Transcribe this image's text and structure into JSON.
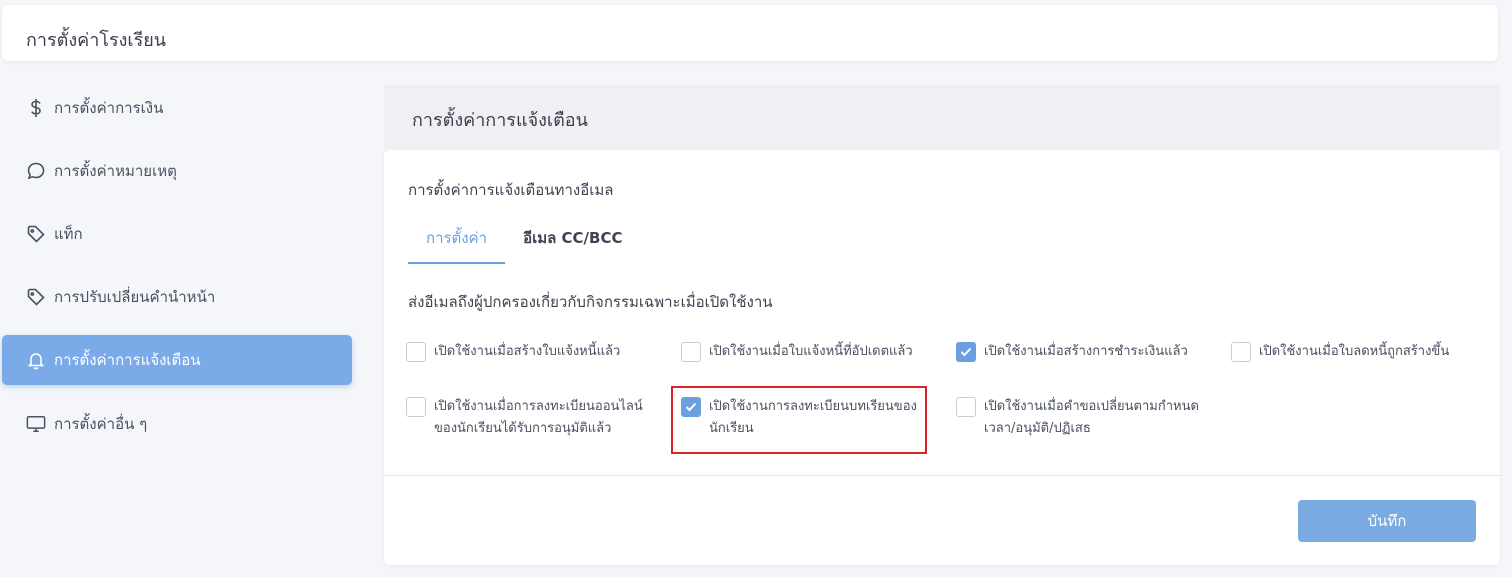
{
  "header": {
    "title": "การตั้งค่าโรงเรียน"
  },
  "sidebar": {
    "items": [
      {
        "label": "การตั้งค่าการเงิน",
        "icon": "dollar-icon"
      },
      {
        "label": "การตั้งค่าหมายเหตุ",
        "icon": "chat-bubble-icon"
      },
      {
        "label": "แท็ก",
        "icon": "tag-icon"
      },
      {
        "label": "การปรับเปลี่ยนคำนำหน้า",
        "icon": "tag-icon"
      },
      {
        "label": "การตั้งค่าการแจ้งเตือน",
        "icon": "bell-icon",
        "active": true
      },
      {
        "label": "การตั้งค่าอื่น ๆ",
        "icon": "monitor-icon"
      }
    ]
  },
  "section": {
    "title": "การตั้งค่าการแจ้งเตือน"
  },
  "card": {
    "title": "การตั้งค่าการแจ้งเตือนทางอีเมล",
    "tabs": [
      {
        "label": "การตั้งค่า",
        "active": true
      },
      {
        "label": "อีเมล CC/BCC",
        "active": false
      }
    ],
    "description": "ส่งอีเมลถึงผู้ปกครองเกี่ยวกับกิจกรรมเฉพาะเมื่อเปิดใช้งาน",
    "options": [
      {
        "lines": [
          "เปิดใช้งานเมื่อสร้างใบแจ้งหนี้แล้ว"
        ],
        "checked": false
      },
      {
        "lines": [
          "เปิดใช้งานเมื่อใบแจ้งหนี้ที่อัปเดตแล้ว"
        ],
        "checked": false
      },
      {
        "lines": [
          "เปิดใช้งานเมื่อสร้างการชำระเงินแล้ว"
        ],
        "checked": true
      },
      {
        "lines": [
          "เปิดใช้งานเมื่อใบลดหนี้ถูกสร้างขึ้น"
        ],
        "checked": false
      },
      {
        "lines": [
          "เปิดใช้งานเมื่อการลงทะเบียนออนไลน์",
          "ของนักเรียนได้รับการอนุมัติแล้ว"
        ],
        "checked": false
      },
      {
        "lines": [
          "เปิดใช้งานการลงทะเบียนบทเรียนของ",
          "นักเรียน"
        ],
        "checked": true
      },
      {
        "lines": [
          "เปิดใช้งานเมื่อคำขอเปลี่ยนตามกำหนด",
          "เวลา/อนุมัติ/ปฏิเสธ"
        ],
        "checked": false
      }
    ],
    "save_label": "บันทึก"
  },
  "colors": {
    "accent": "#6a9fe0",
    "sidebar_active": "#7aabe8",
    "highlight": "#d9232b"
  }
}
